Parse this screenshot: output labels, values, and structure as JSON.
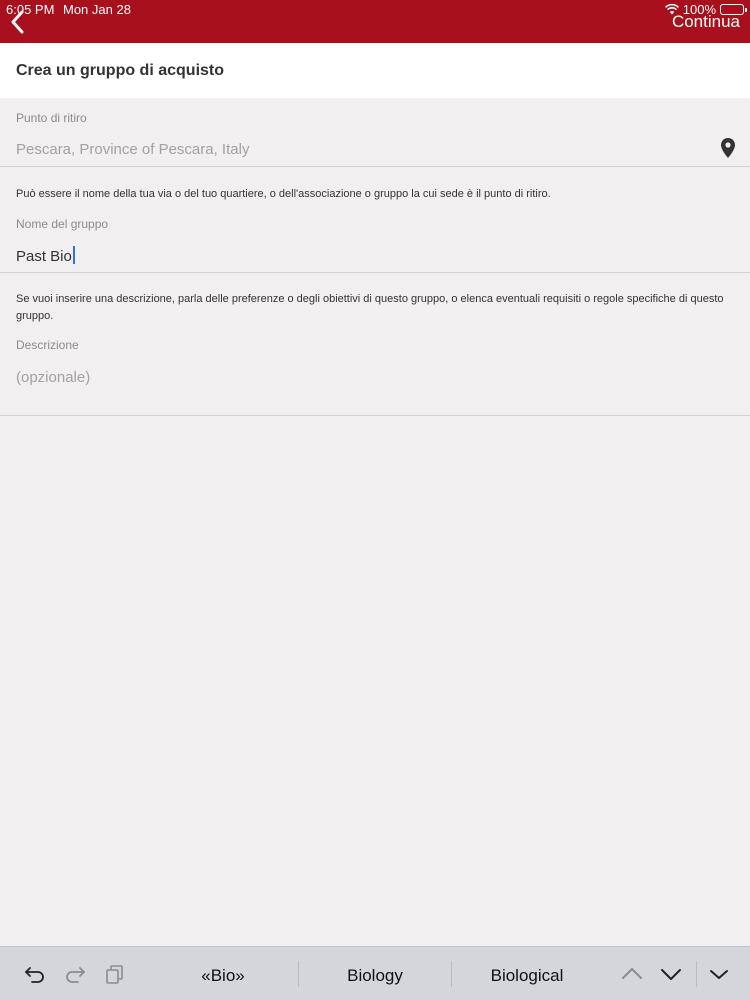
{
  "status_bar": {
    "time": "6:05 PM",
    "date": "Mon Jan 28",
    "battery": "100%"
  },
  "nav": {
    "continue_label": "Continua",
    "back_icon": "chevron-left-icon"
  },
  "header": {
    "title": "Crea un gruppo di acquisto"
  },
  "form": {
    "pickup": {
      "label": "Punto di ritiro",
      "placeholder": "Pescara, Province of Pescara, Italy",
      "icon": "map-pin-icon"
    },
    "pickup_hint": "Può essere il nome della tua via o del tuo quartiere, o dell'associazione o gruppo la cui sede è il punto di ritiro.",
    "group_name": {
      "label": "Nome del gruppo",
      "value": "Past Bio"
    },
    "description_hint": "Se vuoi inserire una descrizione, parla delle preferenze o degli obiettivi di questo gruppo, o elenca eventuali requisiti o regole specifiche di questo gruppo.",
    "description": {
      "label": "Descrizione",
      "placeholder": "(opzionale)"
    }
  },
  "keyboard_bar": {
    "suggestions": [
      "«Bio»",
      "Biology",
      "Biological"
    ],
    "tools": [
      "undo-icon",
      "redo-icon",
      "paste-icon"
    ],
    "nav": [
      "chevron-up-icon",
      "chevron-down-icon",
      "dismiss-keyboard-icon"
    ]
  },
  "colors": {
    "brand_red": "#a8101d",
    "background": "#f1eff0",
    "caret": "#2f6fe0"
  }
}
